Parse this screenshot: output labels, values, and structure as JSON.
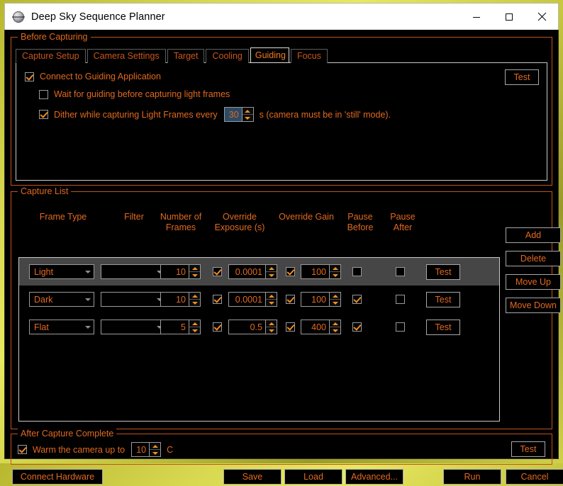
{
  "window": {
    "title": "Deep Sky Sequence Planner",
    "icon": "planet-icon",
    "controls": [
      {
        "name": "minimize",
        "glyph": "minimize-icon"
      },
      {
        "name": "maximize",
        "glyph": "maximize-icon"
      },
      {
        "name": "close",
        "glyph": "close-icon"
      }
    ]
  },
  "colors": {
    "accent_orange": "#e2691f",
    "accent_orange_bright": "#f07b22",
    "group_border": "#c0541a",
    "control_border": "#9a9a9a",
    "background": "#000000",
    "selection_row": "#464646",
    "spin_highlight": "#2c4a66",
    "desktop": "#d8d850"
  },
  "before_capturing": {
    "legend": "Before Capturing",
    "tabs": [
      {
        "label": "Capture Setup",
        "selected": false
      },
      {
        "label": "Camera Settings",
        "selected": false
      },
      {
        "label": "Target",
        "selected": false
      },
      {
        "label": "Cooling",
        "selected": false
      },
      {
        "label": "Guiding",
        "selected": true
      },
      {
        "label": "Focus",
        "selected": false
      }
    ],
    "guiding": {
      "connect": {
        "label": "Connect to Guiding Application",
        "checked": true
      },
      "wait": {
        "label": "Wait for guiding before capturing light frames",
        "checked": false
      },
      "dither": {
        "label": "Dither while capturing Light Frames every",
        "checked": true,
        "value": "30",
        "suffix": "s (camera must be in 'still' mode)."
      },
      "test_button": "Test"
    }
  },
  "capture_list": {
    "legend": "Capture List",
    "columns": [
      {
        "id": "frame_type",
        "line1": "Frame Type",
        "line2": ""
      },
      {
        "id": "filter",
        "line1": "Filter",
        "line2": ""
      },
      {
        "id": "number_of_frames",
        "line1": "Number of",
        "line2": "Frames"
      },
      {
        "id": "override_exposure",
        "line1": "Override",
        "line2": "Exposure (s)"
      },
      {
        "id": "override_gain",
        "line1": "Override Gain",
        "line2": ""
      },
      {
        "id": "pause_before",
        "line1": "Pause",
        "line2": "Before"
      },
      {
        "id": "pause_after",
        "line1": "Pause",
        "line2": "After"
      }
    ],
    "rows": [
      {
        "selected": true,
        "frame_type": "Light",
        "filter": "",
        "frames": "10",
        "override_exposure_checked": true,
        "exposure": "0.0001",
        "override_gain_checked": true,
        "gain": "100",
        "pause_before": false,
        "pause_after": false,
        "test_label": "Test"
      },
      {
        "selected": false,
        "frame_type": "Dark",
        "filter": "",
        "frames": "10",
        "override_exposure_checked": true,
        "exposure": "0.0001",
        "override_gain_checked": true,
        "gain": "100",
        "pause_before": true,
        "pause_after": false,
        "test_label": "Test"
      },
      {
        "selected": false,
        "frame_type": "Flat",
        "filter": "",
        "frames": "5",
        "override_exposure_checked": true,
        "exposure": "0.5",
        "override_gain_checked": true,
        "gain": "400",
        "pause_before": true,
        "pause_after": false,
        "test_label": "Test"
      }
    ],
    "side_buttons": [
      {
        "id": "add",
        "label": "Add"
      },
      {
        "id": "delete",
        "label": "Delete"
      },
      {
        "id": "move-up",
        "label": "Move Up"
      },
      {
        "id": "move-down",
        "label": "Move Down"
      }
    ]
  },
  "after_capture": {
    "legend": "After Capture Complete",
    "warm": {
      "label": "Warm the camera up to",
      "checked": true,
      "value": "10",
      "unit": "C"
    },
    "test_button": "Test"
  },
  "bottom_bar": {
    "connect_hardware": "Connect Hardware",
    "save": "Save",
    "load": "Load",
    "advanced": "Advanced...",
    "run": "Run",
    "cancel": "Cancel"
  }
}
